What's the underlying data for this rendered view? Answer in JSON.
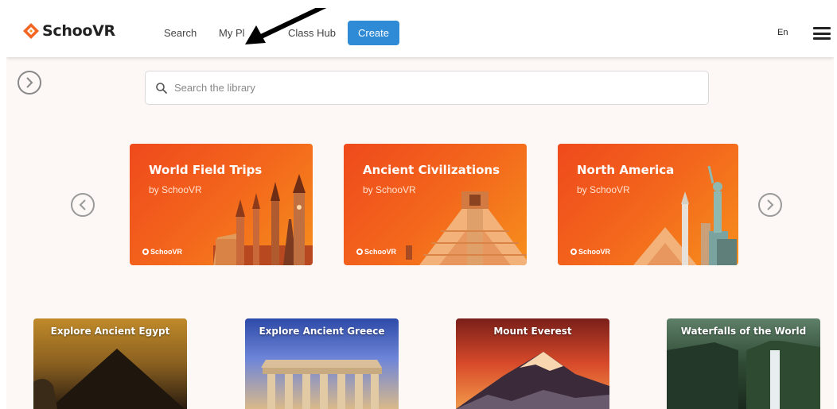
{
  "header": {
    "brand": "SchooVR",
    "nav": {
      "search": "Search",
      "my_places": "My Pl",
      "class_hub": "Class Hub",
      "create": "Create"
    },
    "language": "En",
    "icons": {
      "logo": "schoovr-logo-icon",
      "menu": "hamburger-menu-icon",
      "annotation": "annotation-arrow-icon"
    }
  },
  "sidebar": {
    "toggle_icon": "chevron-right-icon"
  },
  "search": {
    "placeholder": "Search the library",
    "value": "",
    "icon": "search-icon"
  },
  "carousel": {
    "prev_icon": "chevron-left-icon",
    "next_icon": "chevron-right-icon",
    "cards": [
      {
        "title": "World Field Trips",
        "subtitle": "by SchooVR",
        "brand": "SchooVR"
      },
      {
        "title": "Ancient Civilizations",
        "subtitle": "by SchooVR",
        "brand": "SchooVR"
      },
      {
        "title": "North America",
        "subtitle": "by SchooVR",
        "brand": "SchooVR"
      }
    ]
  },
  "tiles": [
    {
      "title": "Explore Ancient Egypt"
    },
    {
      "title": "Explore Ancient Greece"
    },
    {
      "title": "Mount Everest"
    },
    {
      "title": "Waterfalls of the World"
    }
  ],
  "colors": {
    "accent": "#2f8bd6",
    "card_orange": "#f3661c",
    "page_bg": "#fdf8f6"
  }
}
